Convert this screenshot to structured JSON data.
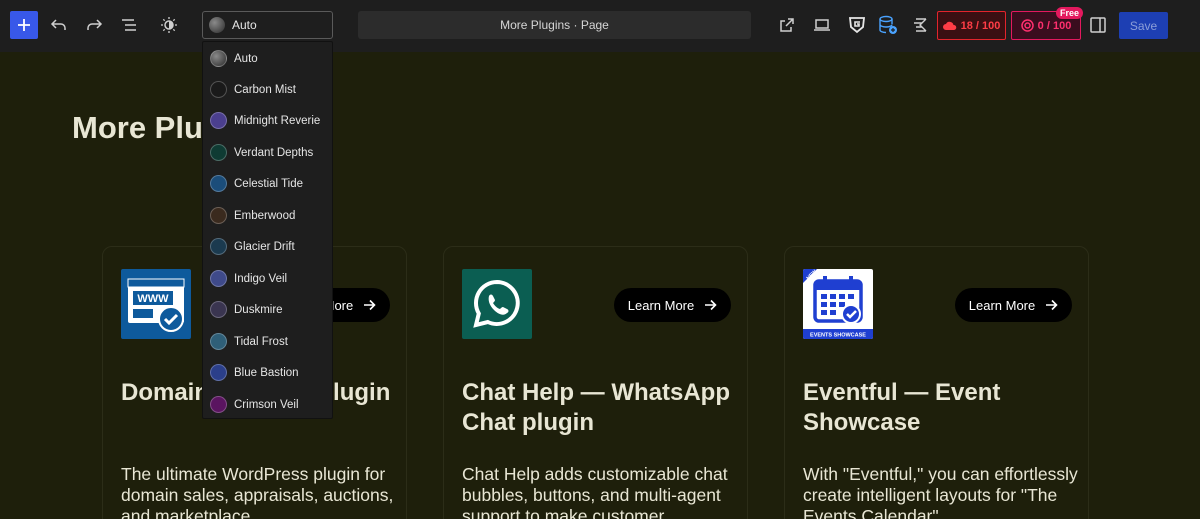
{
  "toolbar": {
    "theme_selected": "Auto",
    "document_title": "More Plugins · Page",
    "quota_a": "18 / 100",
    "quota_b": "0 / 100",
    "free_badge": "Free",
    "save_label": "Save",
    "icons": [
      "plus-icon",
      "undo-icon",
      "redo-icon",
      "list-view-icon",
      "brightness-icon",
      "external-link-icon",
      "laptop-icon",
      "g-shield-icon",
      "database-icon",
      "k-logo-icon",
      "cloud-icon",
      "target-icon",
      "sidebar-toggle-icon"
    ],
    "accent": "#3858e9"
  },
  "theme_options": [
    {
      "label": "Auto",
      "color": "#4a4a4a"
    },
    {
      "label": "Carbon Mist",
      "color": "#1a1a1a"
    },
    {
      "label": "Midnight Reverie",
      "color": "#4b3f8e"
    },
    {
      "label": "Verdant Depths",
      "color": "#0f3b33"
    },
    {
      "label": "Celestial Tide",
      "color": "#1b4d7a"
    },
    {
      "label": "Emberwood",
      "color": "#3a2a1e"
    },
    {
      "label": "Glacier Drift",
      "color": "#1b3a4f"
    },
    {
      "label": "Indigo Veil",
      "color": "#3f4a8a"
    },
    {
      "label": "Duskmire",
      "color": "#3a3550"
    },
    {
      "label": "Tidal Frost",
      "color": "#2f5f78"
    },
    {
      "label": "Blue Bastion",
      "color": "#2b3f8a"
    },
    {
      "label": "Crimson Veil",
      "color": "#5a1460"
    }
  ],
  "main": {
    "heading": "More Plugins",
    "cards": [
      {
        "title": "Domain For Sale Plugin",
        "learn_more": "Learn More",
        "description": "The ultimate WordPress plugin for domain sales, appraisals, auctions, and marketplace",
        "logo": "www-sale-icon"
      },
      {
        "title": "Chat Help — WhatsApp Chat plugin",
        "learn_more": "Learn More",
        "description": "Chat Help adds customizable chat bubbles, buttons, and multi-agent support to make customer",
        "logo": "whatsapp-icon"
      },
      {
        "title": "Eventful — Event Showcase",
        "learn_more": "Learn More",
        "description": "With \"Eventful,\" you can effortlessly create intelligent layouts for \"The Events Calendar\"",
        "logo": "calendar-check-icon",
        "logo_badge": "NEW",
        "logo_caption": "EVENTS SHOWCASE"
      }
    ]
  }
}
